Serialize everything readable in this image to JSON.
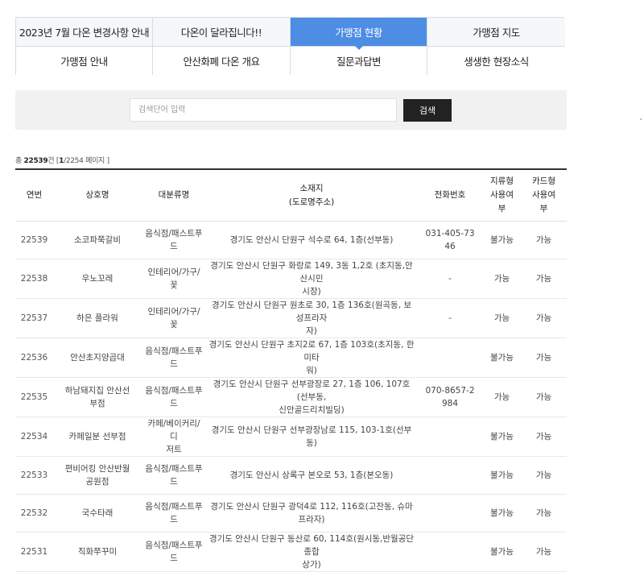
{
  "tabs": [
    {
      "label": "2023년 7월 다온 변경사항 안내",
      "active": false
    },
    {
      "label": "다온이 달라집니다!!",
      "active": false
    },
    {
      "label": "가맹점 현황",
      "active": true
    },
    {
      "label": "가맹점 지도",
      "active": false
    },
    {
      "label": "가맹점 안내",
      "active": false
    },
    {
      "label": "안산화폐 다온 개요",
      "active": false
    },
    {
      "label": "질문과답변",
      "active": false
    },
    {
      "label": "생생한 현장소식",
      "active": false
    }
  ],
  "search": {
    "placeholder": "검색단어 입력",
    "value": "",
    "button_label": "검색"
  },
  "summary": {
    "prefix": "총",
    "total": "22539",
    "unit": "건 [",
    "current_page": "1",
    "total_pages": "/2254 페이지 ]"
  },
  "table": {
    "headers": [
      "연번",
      "상호명",
      "대분류명",
      "소재지\n(도로명주소)",
      "전화번호",
      "지류형\n사용여\n부",
      "카드형\n사용여\n부"
    ],
    "rows": [
      [
        "22539",
        "소코파쭉갈비",
        "음식점/패스트푸\n드",
        "경기도 안산시 단원구 석수로 64, 1층(선부동)",
        "031-405-73\n46",
        "불가능",
        "가능"
      ],
      [
        "22538",
        "우노꼬레",
        "인테리어/가구/꽃",
        "경기도 안산시 단원구 화랑로 149, 3동 1,2호 (초지동,안산시민\n시장)",
        "-",
        "가능",
        "가능"
      ],
      [
        "22537",
        "하은 플라워",
        "인테리어/가구/꽃",
        "경기도 안산시 단원구 원초로 30, 1층 136호(원곡동, 보성프라자\n자)",
        "-",
        "가능",
        "가능"
      ],
      [
        "22536",
        "안산초지양곱대",
        "음식점/패스트푸\n드",
        "경기도 안산시 단원구 초지2로 67, 1층 103호(초지동, 한미타\n워)",
        "",
        "불가능",
        "가능"
      ],
      [
        "22535",
        "하남돼지집 안산선\n부점",
        "음식점/패스트푸\n드",
        "경기도 안산시 단원구 선부광장로 27, 1층 106, 107호(선부동,\n신안골드리치빌딩)",
        "070-8657-2\n984",
        "가능",
        "가능"
      ],
      [
        "22534",
        "카페일분 선부점",
        "카페/베이커리/디\n저트",
        "경기도 안산시 단원구 선부광장남로 115, 103-1호(선부동)",
        "",
        "불가능",
        "가능"
      ],
      [
        "22533",
        "편비어킹 안산반월\n공원점",
        "음식점/패스트푸\n드",
        "경기도 안산시 상록구 본오로 53, 1층(본오동)",
        "",
        "불가능",
        "가능"
      ],
      [
        "22532",
        "국수타래",
        "음식점/패스트푸\n드",
        "경기도 안산시 단원구 광덕4로 112, 116호(고잔동, 슈마프라자)",
        "",
        "불가능",
        "가능"
      ],
      [
        "22531",
        "직화쭈꾸미",
        "음식점/패스트푸\n드",
        "경기도 안산시 단원구 동산로 60, 114호(원시동,반월공단종합\n상가)",
        "",
        "불가능",
        "가능"
      ]
    ]
  }
}
